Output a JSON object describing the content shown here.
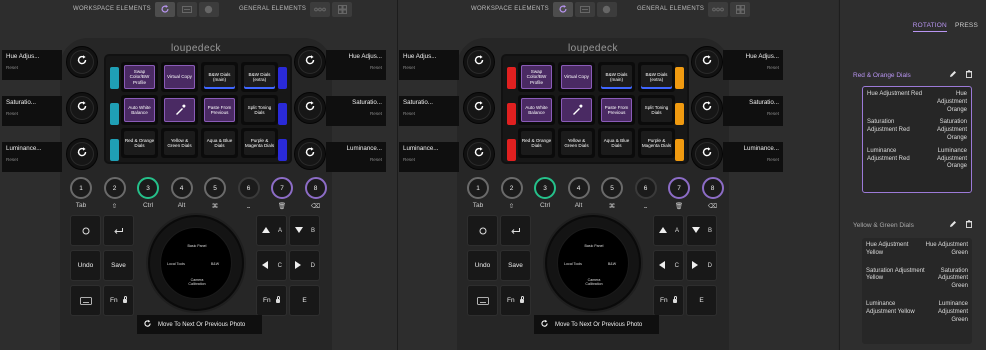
{
  "topbar": {
    "workspace_label": "WORKSPACE ELEMENTS",
    "general_label": "GENERAL ELEMENTS"
  },
  "logo": "loupedeck",
  "dials": [
    {
      "name": "Hue Adjus...",
      "sub": "Reset"
    },
    {
      "name": "Saturatio...",
      "sub": "Reset"
    },
    {
      "name": "Luminance...",
      "sub": "Reset"
    },
    {
      "name": "Hue Adjus...",
      "sub": "Reset"
    },
    {
      "name": "Saturatio...",
      "sub": "Reset"
    },
    {
      "name": "Luminance...",
      "sub": "Reset"
    }
  ],
  "tiles": [
    {
      "label": "Swap Color/BW Profile",
      "style": "purple"
    },
    {
      "label": "Virtual Copy",
      "style": "purple"
    },
    {
      "label": "B&W Dials (main)",
      "style": "blue"
    },
    {
      "label": "B&W Dials (extra)",
      "style": "blue"
    },
    {
      "label": "Auto White Balance",
      "style": "purple"
    },
    {
      "label": "",
      "style": "purple",
      "icon": "eyedropper-icon"
    },
    {
      "label": "Paste From Previous",
      "style": "purple"
    },
    {
      "label": "Split Toning Dials",
      "style": "plain"
    },
    {
      "label": "Red & Orange Dials",
      "style": "plain"
    },
    {
      "label": "Yellow & Green Dials",
      "style": "plain"
    },
    {
      "label": "Aqua & Blue Dials",
      "style": "plain"
    },
    {
      "label": "Purple & Magenta Dials",
      "style": "plain"
    }
  ],
  "side_colors_a": {
    "left": [
      "#1f9fb5",
      "#1f9fb5",
      "#1f9fb5"
    ],
    "right": [
      "#2a2ad8",
      "#2a2ad8",
      "#2a2ad8"
    ]
  },
  "side_colors_b": {
    "left": [
      "#e02020",
      "#e02020",
      "#e02020"
    ],
    "right": [
      "#f09a10",
      "#f09a10",
      "#f09a10"
    ]
  },
  "round_buttons": [
    {
      "num": "1",
      "label": "Tab",
      "ring": "grey"
    },
    {
      "num": "2",
      "label": "⇧",
      "ring": "grey"
    },
    {
      "num": "3",
      "label": "Ctrl",
      "ring": "green"
    },
    {
      "num": "4",
      "label": "Alt",
      "ring": "grey"
    },
    {
      "num": "5",
      "label": "⌘",
      "ring": "grey"
    },
    {
      "num": "6",
      "label": "⎵",
      "ring": "none"
    },
    {
      "num": "7",
      "label": "🗑",
      "ring": "purple"
    },
    {
      "num": "8",
      "label": "⌫",
      "ring": "purple"
    }
  ],
  "left_keys": {
    "undo": "Undo",
    "save": "Save",
    "fn": "Fn"
  },
  "right_keys": {
    "a": "A",
    "b": "B",
    "c": "C",
    "d": "D",
    "fn": "Fn",
    "e": "E"
  },
  "jog": {
    "top": "Basic Panel",
    "left": "Local Tools",
    "right": "B&W",
    "bottom": "Camera Calibration"
  },
  "tooltip": "Move To Next Or Previous Photo",
  "right_panel": {
    "tabs": [
      {
        "label": "ROTATION",
        "active": true
      },
      {
        "label": "PRESS",
        "active": false
      }
    ],
    "groups": [
      {
        "title": "Red & Orange Dials",
        "selected": true,
        "rows": [
          {
            "left": "Hue Adjustment Red",
            "right": "Hue Adjustment Orange"
          },
          {
            "left": "Saturation Adjustment Red",
            "right": "Saturation Adjustment Orange"
          },
          {
            "left": "Luminance Adjustment Red",
            "right": "Luminance Adjustment Orange"
          }
        ]
      },
      {
        "title": "Yellow & Green Dials",
        "selected": false,
        "rows": [
          {
            "left": "Hue Adjustment Yellow",
            "right": "Hue Adjustment Green"
          },
          {
            "left": "Saturation Adjustment Yellow",
            "right": "Saturation Adjustment Green"
          },
          {
            "left": "Luminance Adjustment Yellow",
            "right": "Luminance Adjustment Green"
          }
        ]
      }
    ]
  }
}
